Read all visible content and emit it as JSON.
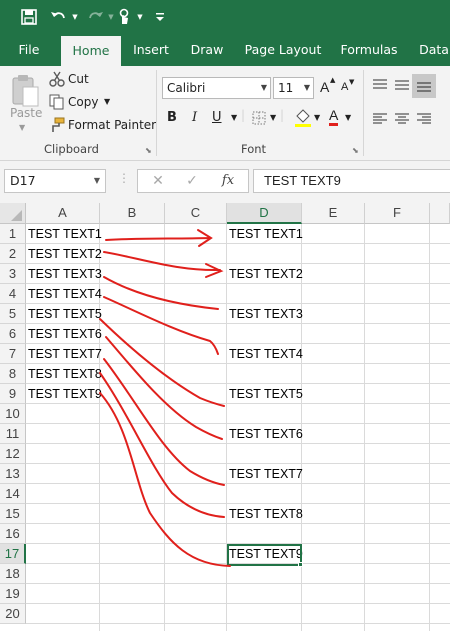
{
  "quick_access": {
    "save_icon": "save-icon",
    "undo_icon": "undo-icon",
    "redo_icon": "redo-icon",
    "touch_icon": "touch-mode-icon",
    "customize_icon": "customize-icon"
  },
  "tabs": [
    "File",
    "Home",
    "Insert",
    "Draw",
    "Page Layout",
    "Formulas",
    "Data"
  ],
  "active_tab": "Home",
  "ribbon": {
    "clipboard": {
      "paste_label": "Paste",
      "cut_label": "Cut",
      "copy_label": "Copy",
      "format_painter_label": "Format Painter",
      "group_label": "Clipboard"
    },
    "font": {
      "font_name": "Calibri",
      "font_size": "11",
      "bold": "B",
      "italic": "I",
      "underline": "U",
      "grow": "A",
      "shrink": "A",
      "font_color": "A",
      "group_label": "Font"
    }
  },
  "formula_bar": {
    "name_box": "D17",
    "cancel": "✕",
    "enter": "✓",
    "fx": "fx",
    "value": "TEST TEXT9"
  },
  "grid": {
    "columns": [
      "A",
      "B",
      "C",
      "D",
      "E",
      "F"
    ],
    "selected_column": "D",
    "rows": [
      "1",
      "2",
      "3",
      "4",
      "5",
      "6",
      "7",
      "8",
      "9",
      "10",
      "11",
      "12",
      "13",
      "14",
      "15",
      "16",
      "17",
      "18",
      "19",
      "20"
    ],
    "selected_row": "17",
    "column_a": [
      "TEST TEXT1",
      "TEST TEXT2",
      "TEST TEXT3",
      "TEST TEXT4",
      "TEST TEXT5",
      "TEST TEXT6",
      "TEST TEXT7",
      "TEST TEXT8",
      "TEST TEXT9"
    ],
    "column_d": [
      {
        "row": "1",
        "text": "TEST TEXT1"
      },
      {
        "row": "3",
        "text": "TEST TEXT2"
      },
      {
        "row": "5",
        "text": "TEST TEXT3"
      },
      {
        "row": "7",
        "text": "TEST TEXT4"
      },
      {
        "row": "9",
        "text": "TEST TEXT5"
      },
      {
        "row": "11",
        "text": "TEST TEXT6"
      },
      {
        "row": "13",
        "text": "TEST TEXT7"
      },
      {
        "row": "15",
        "text": "TEST TEXT8"
      },
      {
        "row": "17",
        "text": "TEST TEXT9"
      }
    ]
  },
  "colors": {
    "excel_green": "#217346",
    "annotation_red": "#e0201c"
  }
}
